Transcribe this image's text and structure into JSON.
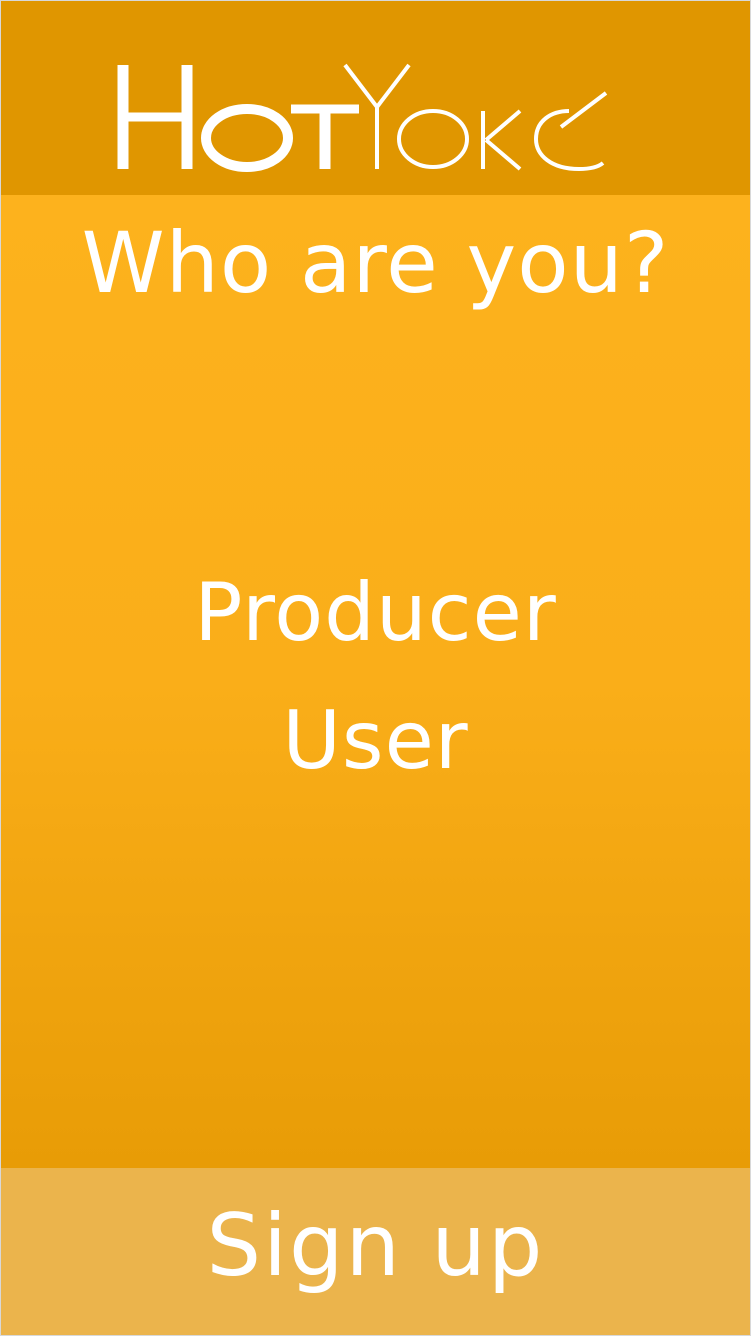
{
  "header": {
    "logo_text": "HOTYOKE"
  },
  "main": {
    "title": "Who are you?",
    "options": [
      {
        "label": "Producer"
      },
      {
        "label": "User"
      }
    ]
  },
  "footer": {
    "signup_label": "Sign up"
  },
  "colors": {
    "header_bg": "#e09600",
    "main_bg": "#fdb21d",
    "footer_bg": "#ebb44c",
    "text": "#ffffff"
  }
}
